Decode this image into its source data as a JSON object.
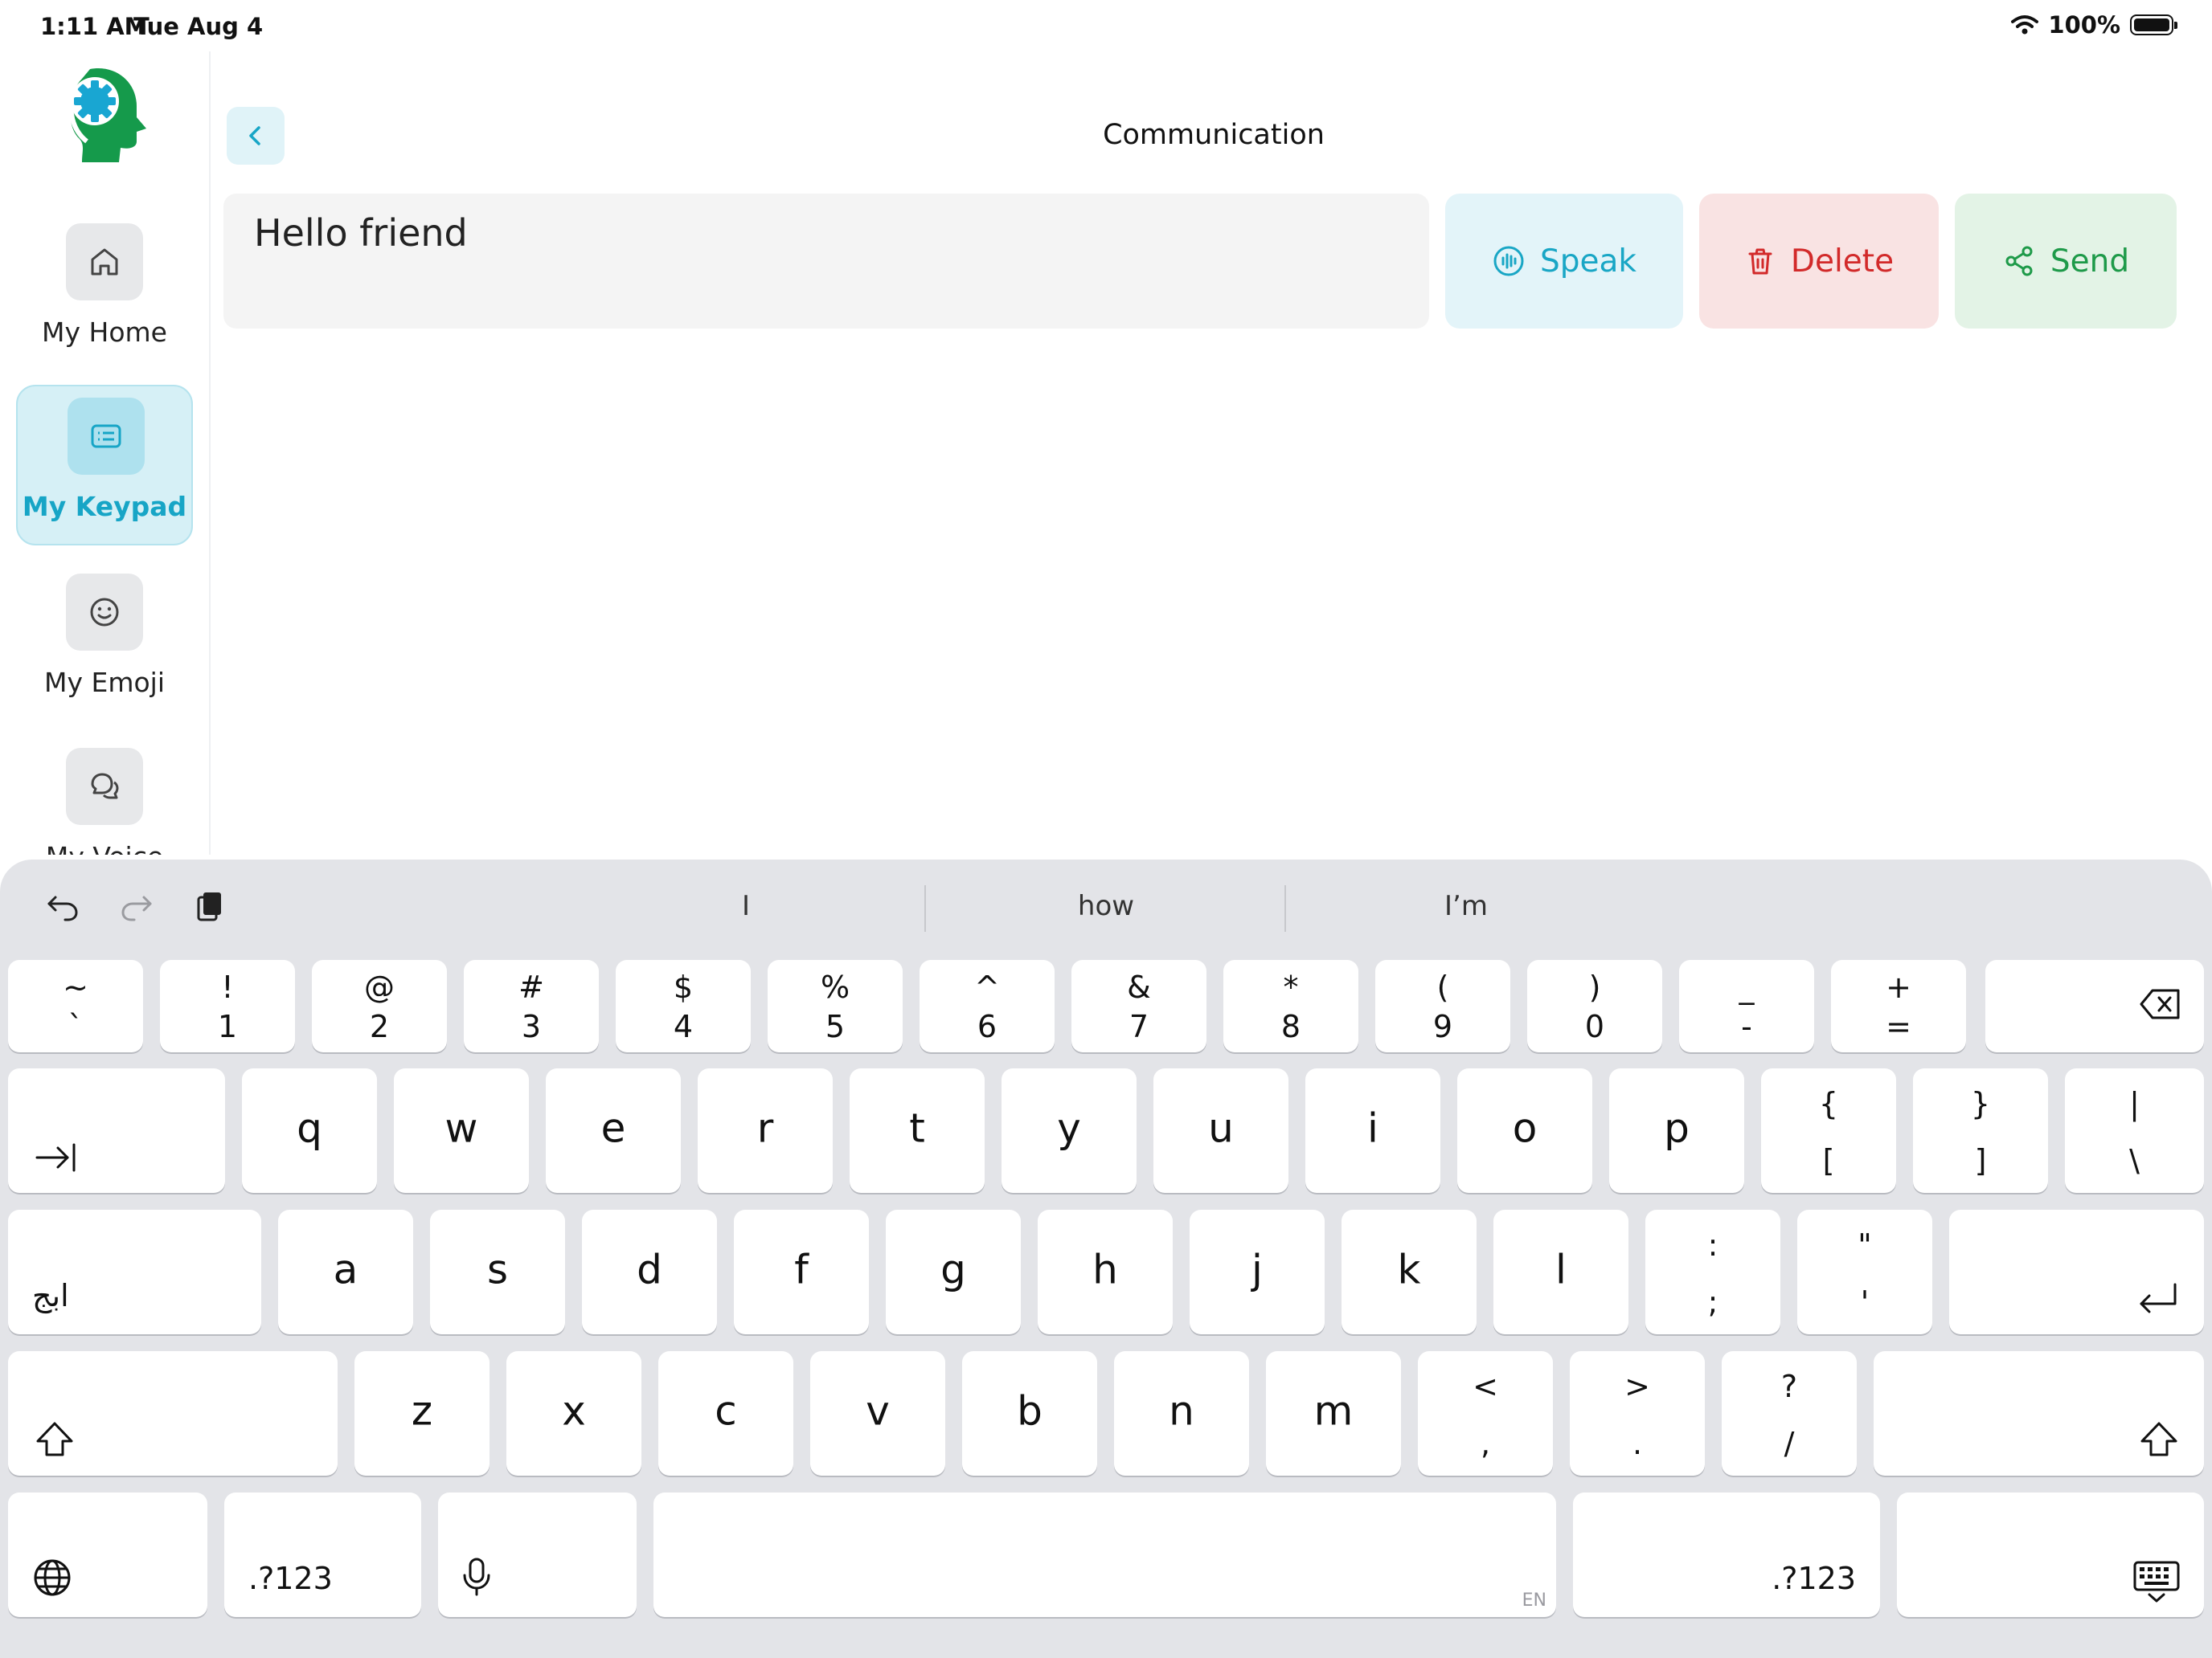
{
  "status_bar": {
    "time": "1:11 AM",
    "date": "Tue Aug 4",
    "battery": "100%"
  },
  "sidebar": {
    "items": [
      {
        "label": "My Home",
        "icon": "home-icon",
        "active": false
      },
      {
        "label": "My Keypad",
        "icon": "keypad-icon",
        "active": true
      },
      {
        "label": "My Emoji",
        "icon": "emoji-icon",
        "active": false
      },
      {
        "label": "My Voice",
        "icon": "chat-icon",
        "active": false
      }
    ]
  },
  "header": {
    "title": "Communication"
  },
  "message": {
    "text": "Hello friend"
  },
  "actions": {
    "speak": "Speak",
    "delete": "Delete",
    "send": "Send"
  },
  "colors": {
    "accent": "#17a5c6",
    "delete": "#d22a2a",
    "send": "#1e9a49"
  },
  "keyboard": {
    "suggestions": [
      "I",
      "how",
      "I’m"
    ],
    "number_row": [
      {
        "top": "~",
        "bot": "`"
      },
      {
        "top": "!",
        "bot": "1"
      },
      {
        "top": "@",
        "bot": "2"
      },
      {
        "top": "#",
        "bot": "3"
      },
      {
        "top": "$",
        "bot": "4"
      },
      {
        "top": "%",
        "bot": "5"
      },
      {
        "top": "^",
        "bot": "6"
      },
      {
        "top": "&",
        "bot": "7"
      },
      {
        "top": "*",
        "bot": "8"
      },
      {
        "top": "(",
        "bot": "9"
      },
      {
        "top": ")",
        "bot": "0"
      },
      {
        "top": "_",
        "bot": "-"
      },
      {
        "top": "+",
        "bot": "="
      }
    ],
    "row_q": [
      "q",
      "w",
      "e",
      "r",
      "t",
      "y",
      "u",
      "i",
      "o",
      "p"
    ],
    "row_q_symbols": [
      {
        "top": "{",
        "bot": "["
      },
      {
        "top": "}",
        "bot": "]"
      },
      {
        "top": "|",
        "bot": "\\"
      }
    ],
    "row_a": [
      "a",
      "s",
      "d",
      "f",
      "g",
      "h",
      "j",
      "k",
      "l"
    ],
    "row_a_symbols": [
      {
        "top": ":",
        "bot": ";"
      },
      {
        "top": "\"",
        "bot": "'"
      }
    ],
    "row_z": [
      "z",
      "x",
      "c",
      "v",
      "b",
      "n",
      "m"
    ],
    "row_z_symbols": [
      {
        "top": "<",
        "bot": ","
      },
      {
        "top": ">",
        "bot": "."
      },
      {
        "top": "?",
        "bot": "/"
      }
    ],
    "language_switch": "ابج",
    "numbers_key": ".?123",
    "space_lang": "EN"
  }
}
